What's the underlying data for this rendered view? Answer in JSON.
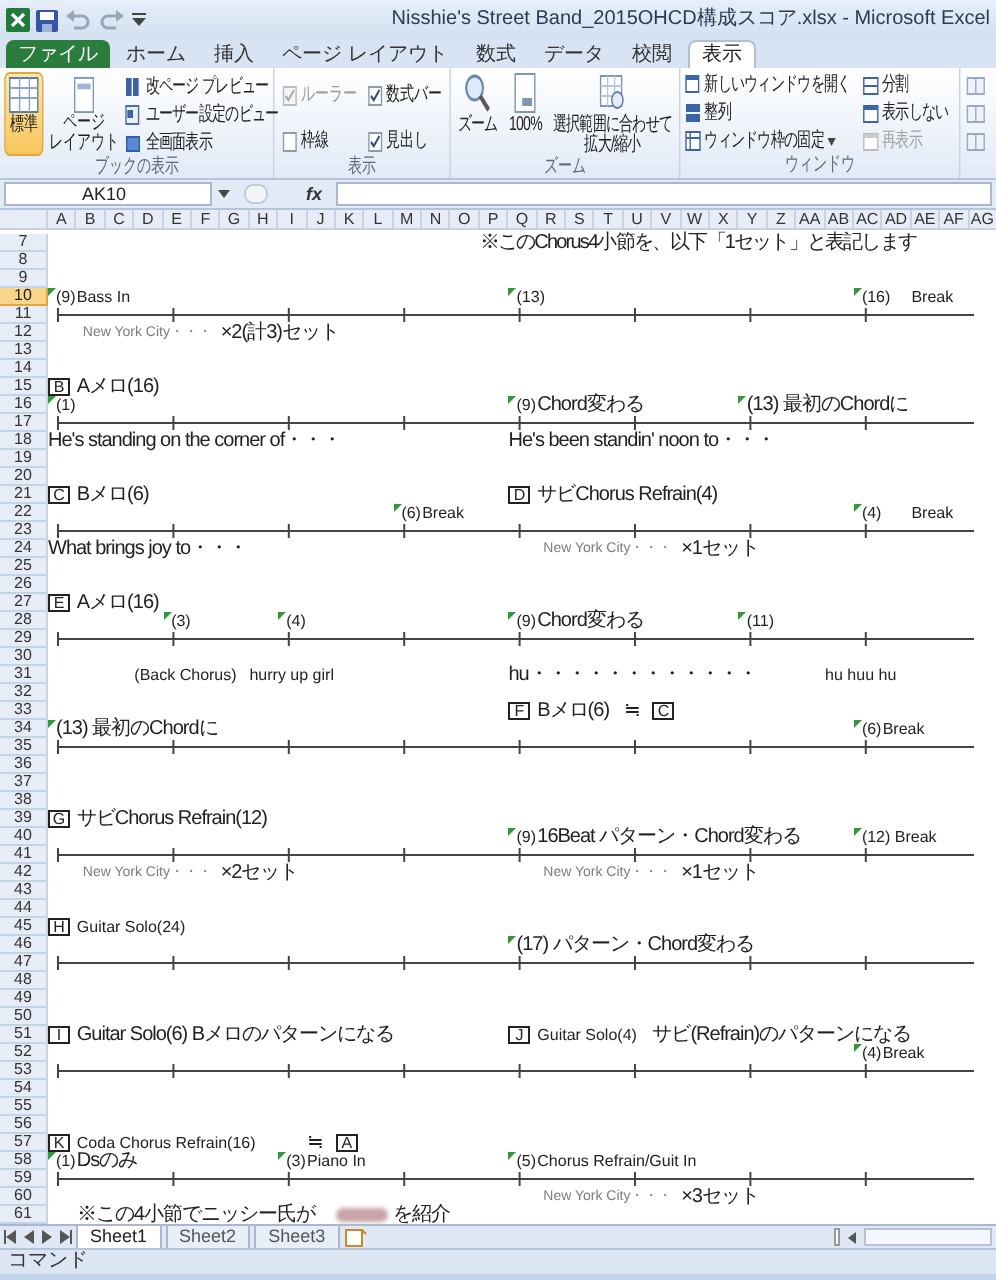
{
  "window": {
    "title": "Nisshie's Street Band_2015OHCD構成スコア.xlsx - Microsoft Excel"
  },
  "ribbon_tabs": [
    {
      "label": "ファイル",
      "kind": "file",
      "selected": false
    },
    {
      "label": "ホーム",
      "kind": "tab",
      "selected": false
    },
    {
      "label": "挿入",
      "kind": "tab",
      "selected": false
    },
    {
      "label": "ページ レイアウト",
      "kind": "tab",
      "selected": false
    },
    {
      "label": "数式",
      "kind": "tab",
      "selected": false
    },
    {
      "label": "データ",
      "kind": "tab",
      "selected": false
    },
    {
      "label": "校閲",
      "kind": "tab",
      "selected": false
    },
    {
      "label": "表示",
      "kind": "tab",
      "selected": true
    }
  ],
  "ribbon": {
    "workbook_views": {
      "label": "ブックの表示",
      "large_buttons": [
        {
          "lines": [
            "標準"
          ],
          "selected": true
        },
        {
          "lines": [
            "ページ",
            "レイアウト"
          ],
          "selected": false
        }
      ],
      "small_buttons": [
        "改ページ プレビュー",
        "ユーザー設定のビュー",
        "全画面表示"
      ]
    },
    "show": {
      "label": "表示",
      "checkboxes": [
        {
          "label": "ルーラー",
          "checked": true,
          "disabled": true
        },
        {
          "label": "数式バー",
          "checked": true,
          "disabled": false
        },
        {
          "label": "枠線",
          "checked": false,
          "disabled": false
        },
        {
          "label": "見出し",
          "checked": true,
          "disabled": false
        }
      ]
    },
    "zoom": {
      "label": "ズーム",
      "buttons": [
        [
          "ズーム"
        ],
        [
          "100%"
        ],
        [
          "選択範囲に合わせて",
          "拡大/縮小"
        ]
      ]
    },
    "window": {
      "label": "ウィンドウ",
      "buttons": [
        {
          "label": "新しいウィンドウを開く",
          "kind": "button",
          "disabled": false
        },
        {
          "label": "整列",
          "kind": "button",
          "disabled": false
        },
        {
          "label": "ウィンドウ枠の固定",
          "kind": "menu",
          "disabled": false
        },
        {
          "label": "分割",
          "kind": "button",
          "disabled": false
        },
        {
          "label": "表示しない",
          "kind": "button",
          "disabled": false
        },
        {
          "label": "再表示",
          "kind": "button",
          "disabled": true
        }
      ]
    }
  },
  "formula_bar": {
    "name_box": "AK10",
    "function_label": "fx"
  },
  "columns": [
    "A",
    "B",
    "C",
    "D",
    "E",
    "F",
    "G",
    "H",
    "I",
    "J",
    "K",
    "L",
    "M",
    "N",
    "O",
    "P",
    "Q",
    "R",
    "S",
    "T",
    "U",
    "V",
    "W",
    "X",
    "Y",
    "Z",
    "AA",
    "AB",
    "AC",
    "AD",
    "AE",
    "AF",
    "AG"
  ],
  "rows": [
    {
      "number": "7",
      "selected": false,
      "kind": "cells",
      "cells": [
        {
          "kind": "text",
          "text": "※このChorus4小節を、以下「1セット」と表記します"
        }
      ]
    },
    {
      "number": "8",
      "selected": false,
      "kind": "blank"
    },
    {
      "number": "9",
      "selected": false,
      "kind": "blank"
    },
    {
      "number": "10",
      "selected": true,
      "kind": "cells",
      "cells": [
        {
          "kind": "flag",
          "text": "(9)"
        },
        {
          "kind": "text",
          "text": "Bass In"
        },
        {
          "kind": "flag",
          "text": "(13)"
        },
        {
          "kind": "flag",
          "text": "(16)"
        },
        {
          "kind": "text",
          "text": "Break"
        }
      ]
    },
    {
      "number": "11",
      "selected": false,
      "kind": "timeline"
    },
    {
      "number": "12",
      "selected": false,
      "kind": "cells",
      "cells": [
        {
          "kind": "blurred",
          "text": "New York City・・・"
        },
        {
          "kind": "text",
          "text": "×2(計3)セット"
        }
      ]
    },
    {
      "number": "13",
      "selected": false,
      "kind": "blank"
    },
    {
      "number": "14",
      "selected": false,
      "kind": "blank"
    },
    {
      "number": "15",
      "selected": false,
      "kind": "cells",
      "cells": [
        {
          "kind": "letter",
          "text": "B"
        },
        {
          "kind": "text",
          "text": "Aメロ(16)"
        }
      ]
    },
    {
      "number": "16",
      "selected": false,
      "kind": "cells",
      "cells": [
        {
          "kind": "flag",
          "text": "(1)"
        },
        {
          "kind": "flag",
          "text": "(9)"
        },
        {
          "kind": "text",
          "text": "Chord変わる"
        },
        {
          "kind": "flag",
          "text": "(13) 最初のChordに"
        }
      ]
    },
    {
      "number": "17",
      "selected": false,
      "kind": "timeline"
    },
    {
      "number": "18",
      "selected": false,
      "kind": "cells",
      "cells": [
        {
          "kind": "text",
          "text": "He's standing on the corner of・・・"
        },
        {
          "kind": "text",
          "text": "He's been standin' noon to・・・"
        }
      ]
    },
    {
      "number": "19",
      "selected": false,
      "kind": "blank"
    },
    {
      "number": "20",
      "selected": false,
      "kind": "blank"
    },
    {
      "number": "21",
      "selected": false,
      "kind": "cells",
      "cells": [
        {
          "kind": "letter",
          "text": "C"
        },
        {
          "kind": "text",
          "text": "Bメロ(6)"
        },
        {
          "kind": "letter",
          "text": "D"
        },
        {
          "kind": "text",
          "text": "サビChorus Refrain(4)"
        }
      ]
    },
    {
      "number": "22",
      "selected": false,
      "kind": "cells",
      "cells": [
        {
          "kind": "flag",
          "text": "(6)"
        },
        {
          "kind": "text",
          "text": "Break"
        },
        {
          "kind": "flag",
          "text": "(4)"
        },
        {
          "kind": "text",
          "text": "Break"
        }
      ]
    },
    {
      "number": "23",
      "selected": false,
      "kind": "timeline"
    },
    {
      "number": "24",
      "selected": false,
      "kind": "cells",
      "cells": [
        {
          "kind": "text",
          "text": "What brings joy to・・・"
        },
        {
          "kind": "blurred",
          "text": "New York City・・・"
        },
        {
          "kind": "text",
          "text": "×1セット"
        }
      ]
    },
    {
      "number": "25",
      "selected": false,
      "kind": "blank"
    },
    {
      "number": "26",
      "selected": false,
      "kind": "blank"
    },
    {
      "number": "27",
      "selected": false,
      "kind": "cells",
      "cells": [
        {
          "kind": "letter",
          "text": "E"
        },
        {
          "kind": "text",
          "text": "Aメロ(16)"
        }
      ]
    },
    {
      "number": "28",
      "selected": false,
      "kind": "cells",
      "cells": [
        {
          "kind": "flag",
          "text": "(3)"
        },
        {
          "kind": "flag",
          "text": "(4)"
        },
        {
          "kind": "flag",
          "text": "(9)"
        },
        {
          "kind": "text",
          "text": "Chord変わる"
        },
        {
          "kind": "flag",
          "text": "(11)"
        }
      ]
    },
    {
      "number": "29",
      "selected": false,
      "kind": "timeline"
    },
    {
      "number": "30",
      "selected": false,
      "kind": "blank"
    },
    {
      "number": "31",
      "selected": false,
      "kind": "cells",
      "cells": [
        {
          "kind": "text",
          "text": "(Back Chorus)"
        },
        {
          "kind": "text",
          "text": "hurry up girl"
        },
        {
          "kind": "text",
          "text": "hu・・・・・・・・・・・・"
        },
        {
          "kind": "text",
          "text": "hu huu hu"
        }
      ]
    },
    {
      "number": "32",
      "selected": false,
      "kind": "blank"
    },
    {
      "number": "33",
      "selected": false,
      "kind": "cells",
      "cells": [
        {
          "kind": "letter",
          "text": "F"
        },
        {
          "kind": "text",
          "text": "Bメロ(6)"
        },
        {
          "kind": "text",
          "text": "≒"
        },
        {
          "kind": "letter",
          "text": "C"
        }
      ]
    },
    {
      "number": "34",
      "selected": false,
      "kind": "cells",
      "cells": [
        {
          "kind": "flag",
          "text": "(13) 最初のChordに"
        },
        {
          "kind": "flag",
          "text": "(6)"
        },
        {
          "kind": "text",
          "text": "Break"
        }
      ]
    },
    {
      "number": "35",
      "selected": false,
      "kind": "timeline"
    },
    {
      "number": "36",
      "selected": false,
      "kind": "blank"
    },
    {
      "number": "37",
      "selected": false,
      "kind": "blank"
    },
    {
      "number": "38",
      "selected": false,
      "kind": "blank"
    },
    {
      "number": "39",
      "selected": false,
      "kind": "cells",
      "cells": [
        {
          "kind": "letter",
          "text": "G"
        },
        {
          "kind": "text",
          "text": "サビChorus Refrain(12)"
        }
      ]
    },
    {
      "number": "40",
      "selected": false,
      "kind": "cells",
      "cells": [
        {
          "kind": "flag",
          "text": "(9)"
        },
        {
          "kind": "text",
          "text": "16Beat パターン・Chord変わる"
        },
        {
          "kind": "flag",
          "text": "(12) Break"
        }
      ]
    },
    {
      "number": "41",
      "selected": false,
      "kind": "timeline"
    },
    {
      "number": "42",
      "selected": false,
      "kind": "cells",
      "cells": [
        {
          "kind": "blurred",
          "text": "New York City・・・"
        },
        {
          "kind": "text",
          "text": "×2セット"
        },
        {
          "kind": "blurred",
          "text": "New York City・・・"
        },
        {
          "kind": "text",
          "text": "×1セット"
        }
      ]
    },
    {
      "number": "43",
      "selected": false,
      "kind": "blank"
    },
    {
      "number": "44",
      "selected": false,
      "kind": "blank"
    },
    {
      "number": "45",
      "selected": false,
      "kind": "cells",
      "cells": [
        {
          "kind": "letter",
          "text": "H"
        },
        {
          "kind": "text",
          "text": "Guitar Solo(24)"
        }
      ]
    },
    {
      "number": "46",
      "selected": false,
      "kind": "cells",
      "cells": [
        {
          "kind": "flag",
          "text": "(17) パターン・Chord変わる"
        }
      ]
    },
    {
      "number": "47",
      "selected": false,
      "kind": "timeline"
    },
    {
      "number": "48",
      "selected": false,
      "kind": "blank"
    },
    {
      "number": "49",
      "selected": false,
      "kind": "blank"
    },
    {
      "number": "50",
      "selected": false,
      "kind": "blank"
    },
    {
      "number": "51",
      "selected": false,
      "kind": "cells",
      "cells": [
        {
          "kind": "letter",
          "text": "I"
        },
        {
          "kind": "text",
          "text": "Guitar Solo(6)  Bメロのパターンになる"
        },
        {
          "kind": "letter",
          "text": "J"
        },
        {
          "kind": "text",
          "text": "Guitar Solo(4)"
        },
        {
          "kind": "text",
          "text": "サビ(Refrain)のパターンになる"
        }
      ]
    },
    {
      "number": "52",
      "selected": false,
      "kind": "cells",
      "cells": [
        {
          "kind": "flag",
          "text": "(4)"
        },
        {
          "kind": "text",
          "text": "Break"
        }
      ]
    },
    {
      "number": "53",
      "selected": false,
      "kind": "timeline"
    },
    {
      "number": "54",
      "selected": false,
      "kind": "blank"
    },
    {
      "number": "55",
      "selected": false,
      "kind": "blank"
    },
    {
      "number": "56",
      "selected": false,
      "kind": "blank"
    },
    {
      "number": "57",
      "selected": false,
      "kind": "cells",
      "cells": [
        {
          "kind": "letter",
          "text": "K"
        },
        {
          "kind": "text",
          "text": "Coda Chorus Refrain(16)"
        },
        {
          "kind": "text",
          "text": "≒"
        },
        {
          "kind": "letter",
          "text": "A"
        }
      ]
    },
    {
      "number": "58",
      "selected": false,
      "kind": "cells",
      "cells": [
        {
          "kind": "flag",
          "text": "(1)"
        },
        {
          "kind": "text",
          "text": "Dsのみ"
        },
        {
          "kind": "flag",
          "text": "(3)"
        },
        {
          "kind": "text",
          "text": "Piano In"
        },
        {
          "kind": "flag",
          "text": "(5)"
        },
        {
          "kind": "text",
          "text": "Chorus Refrain/Guit In"
        }
      ]
    },
    {
      "number": "59",
      "selected": false,
      "kind": "timeline"
    },
    {
      "number": "60",
      "selected": false,
      "kind": "cells",
      "cells": [
        {
          "kind": "blurred",
          "text": "New York City・・・"
        },
        {
          "kind": "text",
          "text": "×3セット"
        }
      ]
    },
    {
      "number": "61",
      "selected": false,
      "kind": "cells",
      "cells": [
        {
          "kind": "text",
          "text": "※この4小節でニッシー氏が"
        },
        {
          "kind": "redacted"
        },
        {
          "kind": "text",
          "text": "を紹介"
        }
      ]
    }
  ],
  "sheet_tabs": [
    {
      "label": "Sheet1",
      "selected": true
    },
    {
      "label": "Sheet2",
      "selected": false
    },
    {
      "label": "Sheet3",
      "selected": false
    }
  ],
  "status_bar": {
    "mode": "コマンド"
  }
}
